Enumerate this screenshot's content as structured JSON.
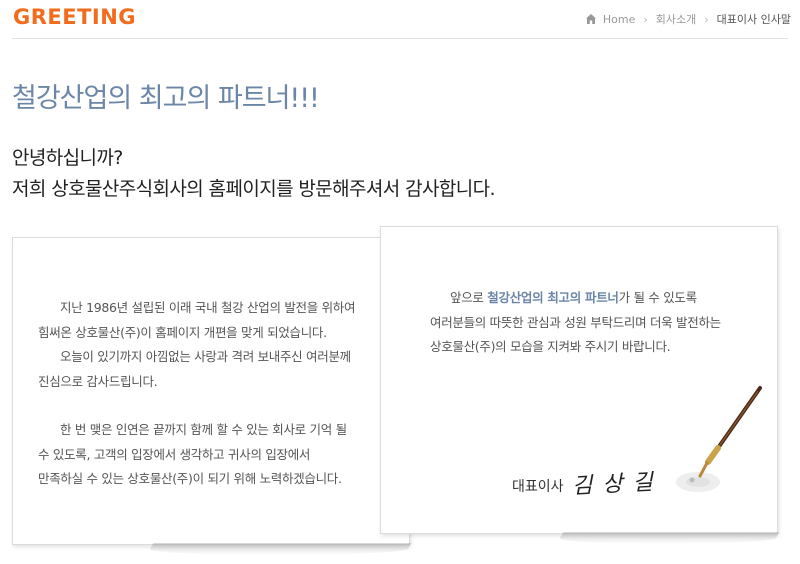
{
  "header": {
    "title": "GREETING",
    "accent_color": "#f26c1e"
  },
  "breadcrumb": {
    "home": "Home",
    "level1": "회사소개",
    "current": "대표이사 인사말"
  },
  "main": {
    "title": "철강산업의 최고의 파트너!!!",
    "intro_line1": "안녕하십니까?",
    "intro_line2": "저희 상호물산주식회사의 홈페이지를 방문해주셔서 감사합니다."
  },
  "card_left": {
    "lines": [
      "지난 1986년 설립된 이래 국내 철강 산업의 발전을 위하여",
      "힘써온 상호물산(주)이 홈페이지 개편을 맞게 되었습니다.",
      "오늘이 있기까지 아낌없는 사랑과 격려 보내주신 여러분께",
      "진심으로 감사드립니다.",
      "한 번 맺은 인연은 끝까지 함께 할 수 있는 회사로 기억 될",
      "수 있도록, 고객의 입장에서 생각하고 귀사의 입장에서",
      "만족하실 수 있는 상호물산(주)이 되기 위해 노력하겠습니다."
    ]
  },
  "card_right": {
    "line1_prefix": "앞으로",
    "line1_highlight": "철강산업의 최고의 파트너",
    "line1_suffix": "가 될 수 있도록",
    "line2": "여러분들의 따뜻한 관심과 성원 부탁드리며 더욱 발전하는",
    "line3": "상호물산(주)의 모습을 지켜봐 주시기 바랍니다.",
    "signature_role": "대표이사",
    "signature_name": "김상길"
  },
  "icons": {
    "home": "home-icon",
    "separator": "chevron-right-icon",
    "pen": "fountain-pen-icon"
  }
}
